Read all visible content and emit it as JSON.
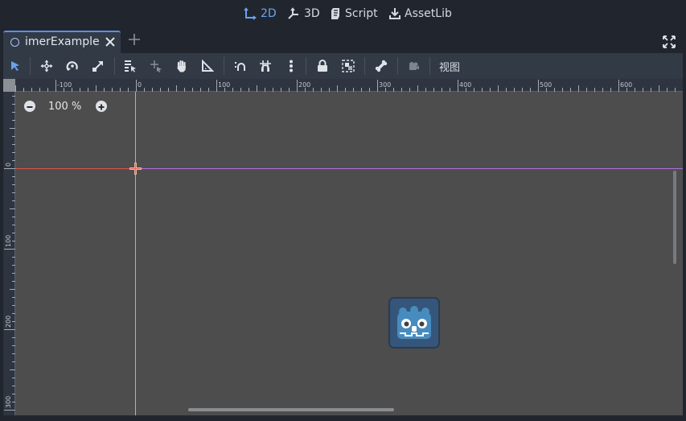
{
  "workspace": {
    "tabs": [
      {
        "label": "2D",
        "icon": "2d-icon",
        "active": true
      },
      {
        "label": "3D",
        "icon": "3d-icon",
        "active": false
      },
      {
        "label": "Script",
        "icon": "script-icon",
        "active": false
      },
      {
        "label": "AssetLib",
        "icon": "assetlib-icon",
        "active": false
      }
    ]
  },
  "scene_tabs": {
    "active_tab_label": "imerExample"
  },
  "toolbar": {
    "view_menu_label": "视图",
    "tools": [
      "select-tool",
      "move-tool",
      "rotate-tool",
      "scale-tool",
      "list-select-tool",
      "pivot-tool",
      "pan-tool",
      "ruler-tool",
      "smart-snap",
      "grid-snap",
      "snap-options",
      "lock",
      "group",
      "skeleton",
      "camera"
    ]
  },
  "rulers": {
    "top_labels": [
      "-100",
      "0",
      "100",
      "200",
      "300",
      "400",
      "500",
      "600"
    ],
    "left_labels": [
      "0",
      "100",
      "200",
      "300"
    ]
  },
  "viewport": {
    "zoom_label": "100 %",
    "background": "#4d4d4d",
    "x_axis_color": "#d9534f",
    "y_axis_color": "#9ccc65",
    "screen_border_color": "#b16ee0"
  },
  "colors": {
    "accent": "#6aa2ee",
    "panel": "#323a46",
    "editor_bg": "#21262e"
  }
}
